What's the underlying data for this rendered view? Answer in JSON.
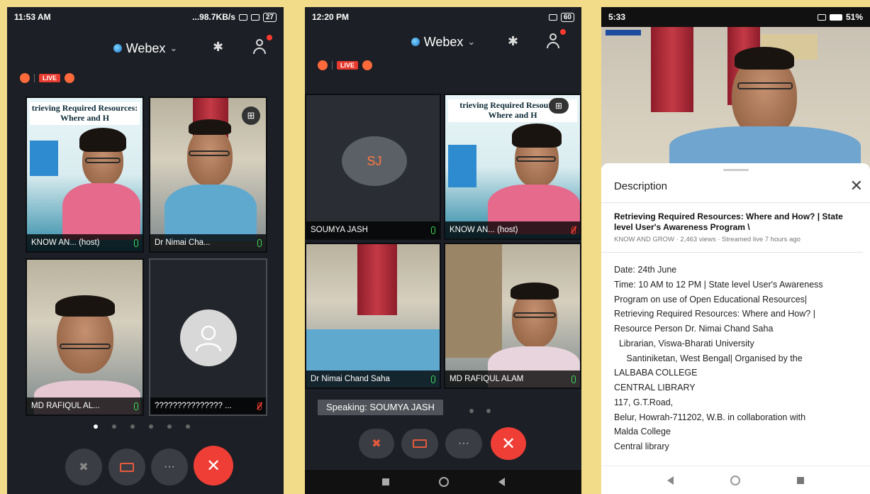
{
  "phone1": {
    "time": "11:53 AM",
    "net_speed": "...98.7KB/s",
    "battery": "27",
    "app_title": "Webex",
    "live_label": "LIVE",
    "tiles": [
      {
        "name": "KNOW AN... (host)",
        "slide_title": "trieving Required Resources: Where and H"
      },
      {
        "name": "Dr Nimai Cha..."
      },
      {
        "name": "MD RAFIQUL AL..."
      },
      {
        "name": "??????????????? ..."
      }
    ]
  },
  "phone2": {
    "time": "12:20 PM",
    "battery": "60",
    "app_title": "Webex",
    "live_label": "LIVE",
    "avatar_initials": "SJ",
    "tiles": [
      {
        "name": "SOUMYA JASH"
      },
      {
        "name": "KNOW AN... (host)",
        "slide_title": "trieving Required Resources: Where and H"
      },
      {
        "name": "Dr Nimai Chand Saha"
      },
      {
        "name": "MD RAFIQUL ALAM"
      }
    ],
    "speaking": "Speaking: SOUMYA JASH"
  },
  "phone3": {
    "time": "5:33",
    "battery": "51%",
    "description_title": "Description",
    "video_title": "Retrieving Required Resources: Where and How? | State level User's Awareness Program \\",
    "video_meta": "KNOW AND GROW · 2,463 views · Streamed live 7 hours ago",
    "description_lines": [
      "Date: 24th June",
      "Time: 10 AM to 12 PM | State level User's Awareness",
      "Program on use of Open Educational Resources|",
      "Retrieving Required Resources: Where and How? |",
      "Resource Person Dr. Nimai Chand Saha",
      "  Librarian, Viswa-Bharati University",
      "     Santiniketan, West Bengal| Organised by the",
      "LALBABA COLLEGE",
      "CENTRAL LIBRARY",
      "117, G.T.Road,",
      "Belur, Howrah-711202, W.B. in collaboration with",
      "Malda College",
      "Central library"
    ]
  },
  "icons": {
    "bluetooth": "bluetooth-icon",
    "participants": "participants-icon",
    "close": "close-icon",
    "layout": "layout-grid-icon"
  }
}
